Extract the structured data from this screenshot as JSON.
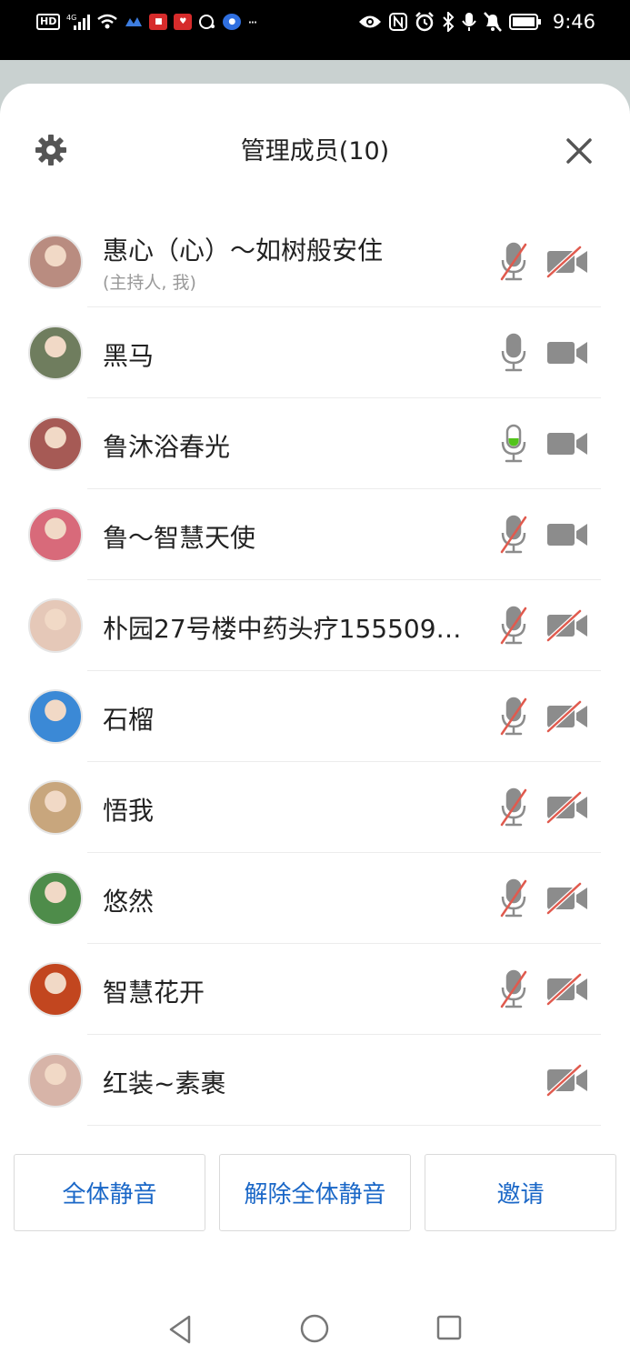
{
  "status_bar": {
    "left_icons": [
      "hd-icon",
      "signal-4g-icon",
      "wifi-icon",
      "app-icon",
      "app-icon",
      "app-icon",
      "app-icon",
      "app-icon",
      "more-icon"
    ],
    "hd_label": "HD",
    "more_label": "···",
    "time": "9:46"
  },
  "header": {
    "title": "管理成员(10)",
    "settings_icon": "gear-icon",
    "close_icon": "close-icon"
  },
  "members": [
    {
      "name": "惠心（心）～如树般安住",
      "subtitle": "(主持人, 我)",
      "mic": "muted",
      "camera": "off",
      "avatar_color": "#b98c80"
    },
    {
      "name": "黑马",
      "subtitle": "",
      "mic": "on",
      "camera": "on",
      "avatar_color": "#6f7d5e"
    },
    {
      "name": "鲁沐浴春光",
      "subtitle": "",
      "mic": "speaking",
      "camera": "on",
      "avatar_color": "#a65a55"
    },
    {
      "name": "鲁～智慧天使",
      "subtitle": "",
      "mic": "muted",
      "camera": "on",
      "avatar_color": "#d86a7a"
    },
    {
      "name": "朴园27号楼中药头疗155509…",
      "subtitle": "",
      "mic": "muted",
      "camera": "off",
      "avatar_color": "#e5c8b8"
    },
    {
      "name": "石榴",
      "subtitle": "",
      "mic": "muted",
      "camera": "off",
      "avatar_color": "#3b89d6"
    },
    {
      "name": "悟我",
      "subtitle": "",
      "mic": "muted",
      "camera": "off",
      "avatar_color": "#c8a67d"
    },
    {
      "name": "悠然",
      "subtitle": "",
      "mic": "muted",
      "camera": "off",
      "avatar_color": "#4e8c4a"
    },
    {
      "name": "智慧花开",
      "subtitle": "",
      "mic": "muted",
      "camera": "off",
      "avatar_color": "#c2461f"
    },
    {
      "name": "红装~素裹",
      "subtitle": "",
      "mic": "none",
      "camera": "off",
      "avatar_color": "#d7b4a8"
    }
  ],
  "actions": {
    "mute_all": "全体静音",
    "unmute_all": "解除全体静音",
    "invite": "邀请"
  },
  "colors": {
    "accent": "#1a67c7",
    "icon_gray": "#8c8c8c",
    "muted_slash": "#e05a4e",
    "speaking": "#52c41a"
  },
  "nav": {
    "back_icon": "back-triangle-icon",
    "home_icon": "home-circle-icon",
    "recent_icon": "recent-square-icon"
  }
}
